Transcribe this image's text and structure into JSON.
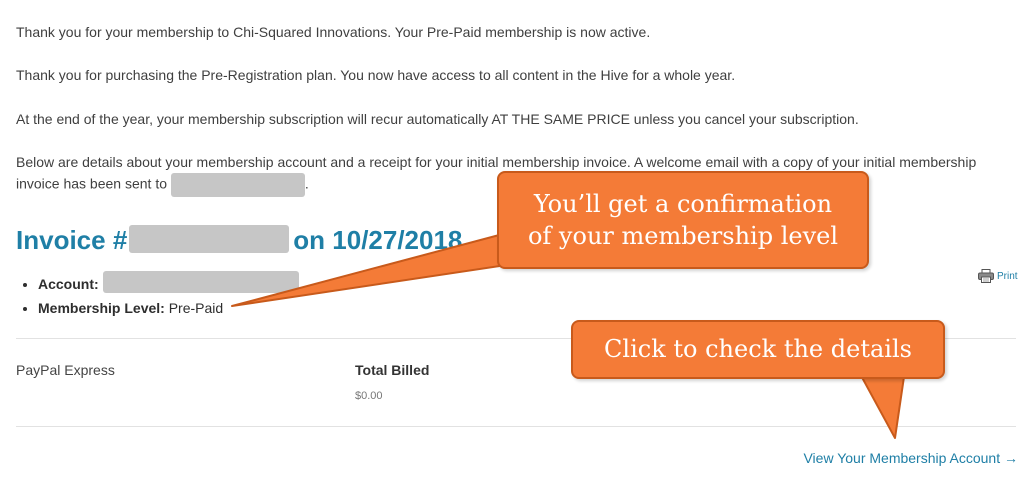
{
  "messages": {
    "thank_you": "Thank you for your membership to Chi-Squared Innovations. Your Pre-Paid membership is now active.",
    "plan": "Thank you for purchasing the Pre-Registration plan. You now have access to all content in the Hive for a whole year.",
    "recurring": "At the end of the year, your membership subscription will recur automatically AT THE SAME PRICE unless you cancel your subscription.",
    "details_intro": "Below are details about your membership account and a receipt for your initial membership invoice. A welcome email with a copy of your initial membership invoice has been sent to",
    "details_end": "."
  },
  "invoice": {
    "prefix": "Invoice #",
    "date_text": "on 10/27/2018",
    "account_label": "Account:",
    "level_label": "Membership Level:",
    "level_value": "Pre-Paid",
    "print_label": "Print",
    "print_icon": "printer-icon"
  },
  "billing": {
    "method": "PayPal Express",
    "total_label": "Total Billed",
    "total_value": "$0.00"
  },
  "link": {
    "view_account": "View Your Membership Account →"
  },
  "callouts": {
    "confirmation_line1": "You’ll get a confirmation",
    "confirmation_line2": "of your membership level",
    "check_details": "Click to check the details"
  },
  "colors": {
    "callout_fill": "#f47b37",
    "callout_border": "#c85a1b",
    "link_blue": "#1f7fa6",
    "redaction_gray": "#c6c6c6"
  }
}
